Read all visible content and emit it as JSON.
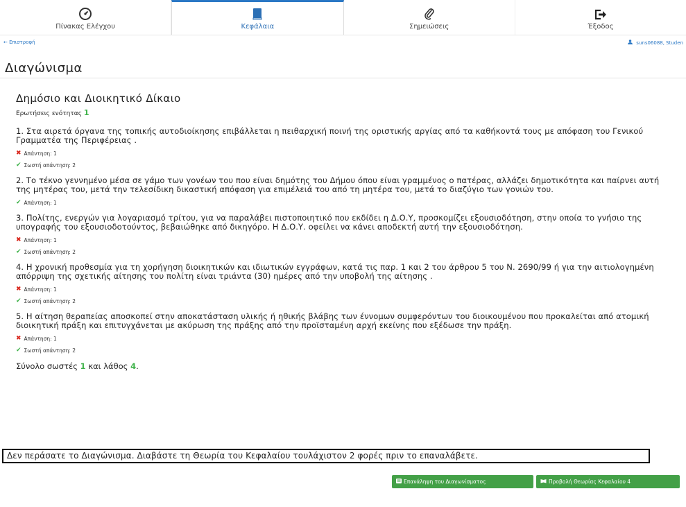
{
  "nav": {
    "items": [
      {
        "label": "Πίνακας Ελέγχου",
        "icon": "dashboard-icon"
      },
      {
        "label": "Κεφάλαια",
        "icon": "book-icon"
      },
      {
        "label": "Σημειώσεις",
        "icon": "paperclip-icon"
      },
      {
        "label": "Έξοδος",
        "icon": "sign-out-icon"
      }
    ],
    "active_index": 1
  },
  "back_link": "← Επιστροφή",
  "user": "suns06088, Studen",
  "page_title": "Διαγώνισμα",
  "section": {
    "title": "Δημόσιο και Διοικητικό Δίκαιο",
    "questions_label": "Ερωτήσεις ενότητας",
    "questions_count": "1"
  },
  "questions": [
    {
      "text": "1. Στα αιρετά όργανα της τοπικής αυτοδιοίκησης επιβάλλεται η πειθαρχική ποινή της οριστικής αργίας από τα καθήκοντά τους με απόφαση του Γενικού Γραμματέα της Περιφέρειας .",
      "answer": "Απάντηση: 1",
      "correct_answer": "Σωστή απάντηση: 2"
    },
    {
      "text": "2. Το τέκνο γεννημένο μέσα σε γάμο των γονέων του που είναι δημότης του Δήμου όπου είναι γραμμένος ο πατέρας, αλλάζει δημοτικότητα και παίρνει αυτή της μητέρας του, μετά την τελεσίδικη δικαστική απόφαση για επιμέλειά του από τη μητέρα του, μετά το διαζύγιο των γονιών του.",
      "answer": "Απάντηση: 1"
    },
    {
      "text": "3. Πολίτης, ενεργών για λογαριασμό τρίτου, για να παραλάβει πιστοποιητικό που εκδίδει η Δ.Ο.Υ, προσκομίζει εξουσιοδότηση, στην οποία το γνήσιο της υπογραφής του εξουσιοδοτούντος, βεβαιώθηκε από δικηγόρο. Η Δ.Ο.Υ. οφείλει να κάνει αποδεκτή αυτή την εξουσιοδότηση.",
      "answer": "Απάντηση: 1",
      "correct_answer": "Σωστή απάντηση: 2"
    },
    {
      "text": "4. Η χρονική προθεσμία για τη χορήγηση διοικητικών και ιδιωτικών εγγράφων, κατά τις παρ. 1 και 2 του άρθρου 5 του Ν. 2690/99 ή για την αιτιολογημένη απόρριψη της σχετικής αίτησης του πολίτη είναι τριάντα (30) ημέρες από την υποβολή της αίτησης .",
      "answer": "Απάντηση: 1",
      "correct_answer": "Σωστή απάντηση: 2"
    },
    {
      "text": "5. Η αίτηση θεραπείας αποσκοπεί στην αποκατάσταση υλικής ή ηθικής βλάβης των έννομων συμφερόντων του διοικουμένου που προκαλείται από ατομική διοικητική πράξη και επιτυγχάνεται με ακύρωση της πράξης από την προϊσταμένη αρχή εκείνης που εξέδωσε την πράξη.",
      "answer": "Απάντηση: 1",
      "correct_answer": "Σωστή απάντηση: 2"
    }
  ],
  "totals": {
    "prefix": "Σύνολο σωστές",
    "correct": "1",
    "middle": "και λάθος",
    "wrong": "4",
    "suffix": "."
  },
  "fail_message": "Δεν περάσατε το Διαγώνισμα. Διαβάστε τη Θεωρία του Κεφαλαίου τουλάχιστον 2 φορές πριν το επαναλάβετε.",
  "buttons": {
    "repeat": "Επανάληψη του Διαγωνίσματος",
    "theory": "Προβολή Θεωρίας Κεφαλαίου 4"
  },
  "colors": {
    "accent": "#2b78c5",
    "success": "#43a047",
    "error": "#d9261c"
  }
}
